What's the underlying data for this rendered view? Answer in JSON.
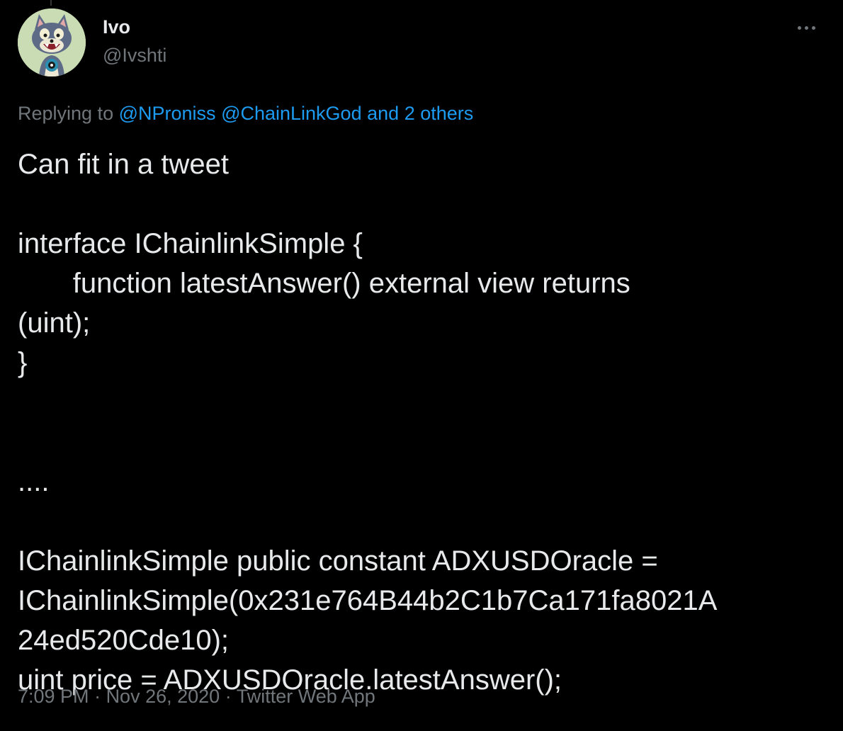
{
  "colors": {
    "background": "#000000",
    "text_primary": "#e7e9ea",
    "text_secondary": "#71767b",
    "link": "#1d9bf0"
  },
  "author": {
    "display_name": "Ivo",
    "handle": "@Ivshti",
    "avatar_icon": "cartoon-cat-avatar"
  },
  "more_icon": "more-dots-icon",
  "reply": {
    "prefix": "Replying to ",
    "mention_1": "@NProniss",
    "mention_2": "@ChainLinkGod",
    "connector": "and",
    "others": "2 others"
  },
  "tweet": {
    "lines": [
      "Can fit in a tweet",
      "",
      "interface IChainlinkSimple {",
      "       function latestAnswer() external view returns",
      "(uint);",
      "}",
      "",
      "",
      "....",
      "",
      "IChainlinkSimple public constant ADXUSDOracle =",
      "IChainlinkSimple(0x231e764B44b2C1b7Ca171fa8021A",
      "24ed520Cde10);",
      "uint price = ADXUSDOracle.latestAnswer();"
    ]
  },
  "meta": {
    "time": "7:09 PM",
    "separator": " · ",
    "date": "Nov 26, 2020",
    "source": "Twitter Web App"
  }
}
